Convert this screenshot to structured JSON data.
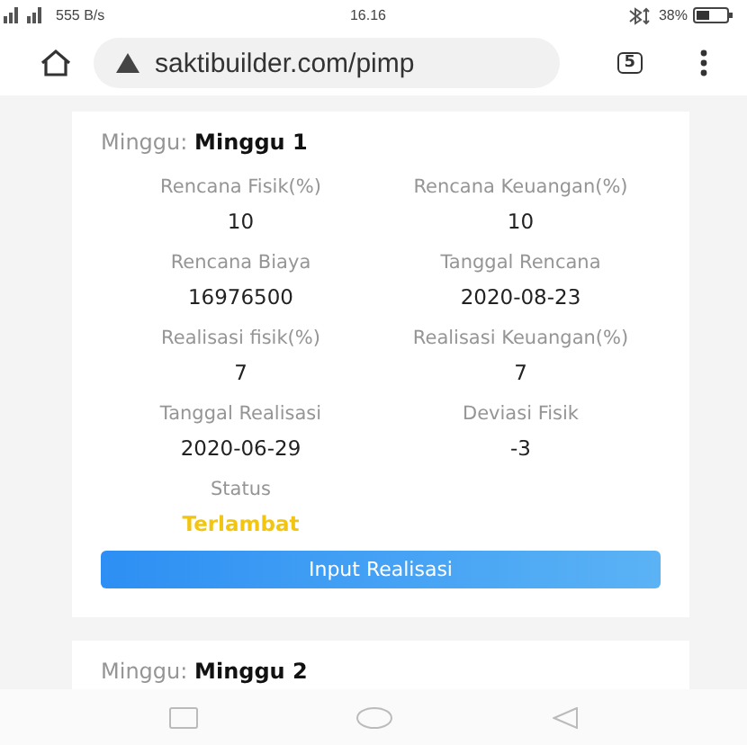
{
  "status_bar": {
    "network_speed": "555 B/s",
    "time": "16.16",
    "battery": "38%"
  },
  "browser": {
    "url": "saktibuilder.com/pimp",
    "tab_count": "5"
  },
  "cards": [
    {
      "week_label": "Minggu:",
      "week": "Minggu 1",
      "fields": [
        {
          "label": "Rencana Fisik(%)",
          "value": "10"
        },
        {
          "label": "Rencana Keuangan(%)",
          "value": "10"
        },
        {
          "label": "Rencana Biaya",
          "value": "16976500"
        },
        {
          "label": "Tanggal Rencana",
          "value": "2020-08-23"
        },
        {
          "label": "Realisasi fisik(%)",
          "value": "7"
        },
        {
          "label": "Realisasi Keuangan(%)",
          "value": "7"
        },
        {
          "label": "Tanggal Realisasi",
          "value": "2020-06-29"
        },
        {
          "label": "Deviasi Fisik",
          "value": "-3"
        },
        {
          "label": "Status",
          "value": "Terlambat",
          "kind": "status"
        }
      ],
      "button": "Input Realisasi"
    },
    {
      "week_label": "Minggu:",
      "week": "Minggu 2"
    }
  ]
}
